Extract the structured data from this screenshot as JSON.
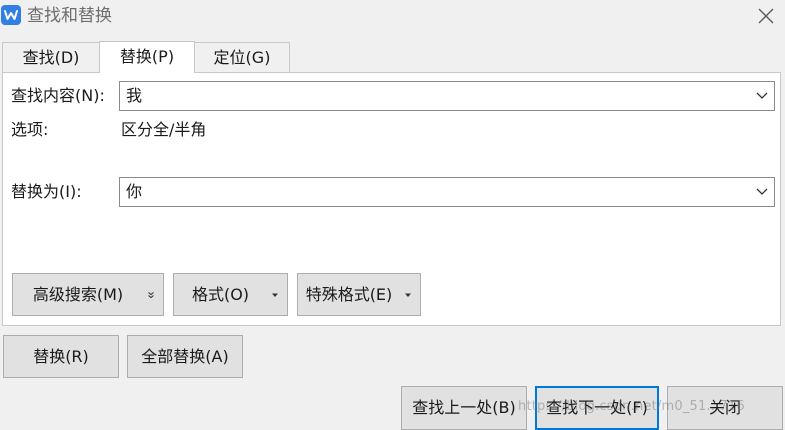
{
  "window": {
    "title": "查找和替换"
  },
  "tabs": [
    {
      "label": "查找(D)",
      "active": false
    },
    {
      "label": "替换(P)",
      "active": true
    },
    {
      "label": "定位(G)",
      "active": false
    }
  ],
  "find": {
    "label": "查找内容(N):",
    "value": "我"
  },
  "options": {
    "label": "选项:",
    "value": "区分全/半角"
  },
  "replace": {
    "label": "替换为(I):",
    "value": "你"
  },
  "panel_buttons": {
    "advanced": "高级搜索(M)",
    "format": "格式(O)",
    "special": "特殊格式(E)"
  },
  "actions": {
    "replace": "替换(R)",
    "replace_all": "全部替换(A)"
  },
  "footer": {
    "find_prev": "查找上一处(B)",
    "find_next": "查找下一处(F)",
    "close": "关闭"
  },
  "watermark": "https://blog.csdn.net/m0_51...716",
  "colors": {
    "accent": "#0078d7",
    "app_icon": "#2f7fe5"
  },
  "icons": {
    "app": "wps-writer-icon",
    "close": "close-icon",
    "dropdown": "chevron-down-icon"
  }
}
